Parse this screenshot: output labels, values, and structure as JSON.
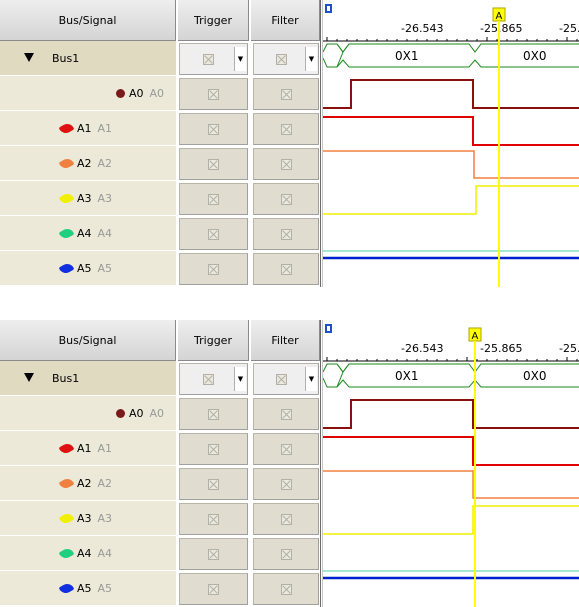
{
  "headers": {
    "bus_signal": "Bus/Signal",
    "trigger": "Trigger",
    "filter": "Filter"
  },
  "ruler": {
    "tick_labels": [
      "-26.543",
      "-25.865",
      "-25."
    ],
    "cursor_label": "A"
  },
  "bus": {
    "name": "Bus1",
    "values": [
      "0X1",
      "0X0"
    ]
  },
  "signals": [
    {
      "name": "A0",
      "alias": "A0",
      "color": "#7a1a1a",
      "icon": "dot-icon"
    },
    {
      "name": "A1",
      "alias": "A1",
      "color": "#e01010",
      "icon": "probe-icon"
    },
    {
      "name": "A2",
      "alias": "A2",
      "color": "#f08040",
      "icon": "probe-icon"
    },
    {
      "name": "A3",
      "alias": "A3",
      "color": "#f0f000",
      "icon": "probe-icon"
    },
    {
      "name": "A4",
      "alias": "A4",
      "color": "#20d080",
      "icon": "probe-icon"
    },
    {
      "name": "A5",
      "alias": "A5",
      "color": "#1030e0",
      "icon": "probe-icon"
    }
  ],
  "colors": {
    "bus_trace": "#1a8a1a",
    "a0_trace": "#8a1010",
    "a1_trace": "#e00000",
    "a2_trace": "#f08040",
    "a3_trace": "#f0f000",
    "a4_trace": "#40d0a0",
    "a5_trace": "#0020d0",
    "cursor": "#ffff00",
    "header_bg": "#d4d4d4",
    "name_cell_bg": "#ece9d8"
  },
  "panels": [
    {
      "id": "top",
      "cursor_state": "cursor offset from transition"
    },
    {
      "id": "bottom",
      "cursor_state": "cursor on transition"
    }
  ]
}
